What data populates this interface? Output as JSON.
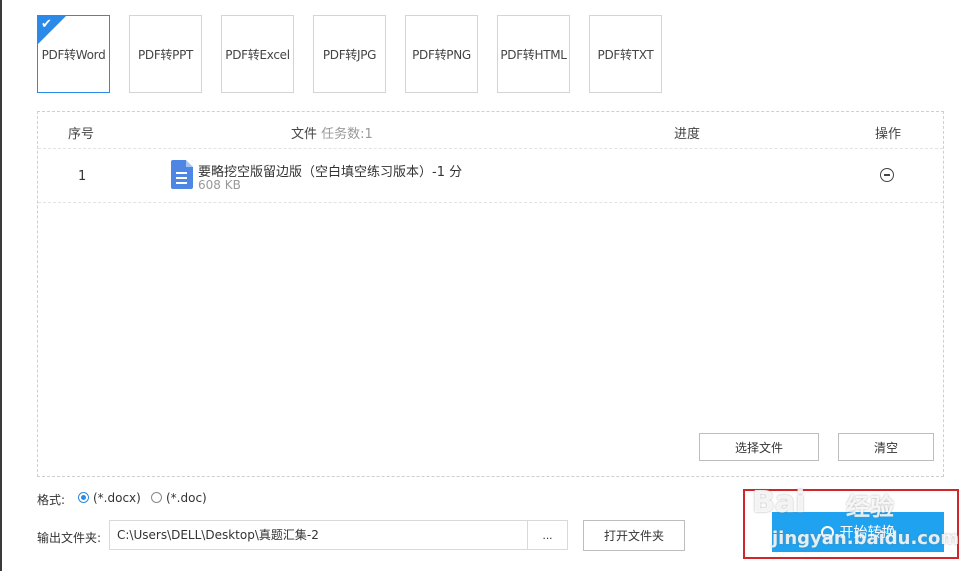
{
  "tabs": [
    {
      "label": "PDF转Word",
      "active": true
    },
    {
      "label": "PDF转PPT",
      "active": false
    },
    {
      "label": "PDF转Excel",
      "active": false
    },
    {
      "label": "PDF转JPG",
      "active": false
    },
    {
      "label": "PDF转PNG",
      "active": false
    },
    {
      "label": "PDF转HTML",
      "active": false
    },
    {
      "label": "PDF转TXT",
      "active": false
    }
  ],
  "table": {
    "col_index": "序号",
    "col_file": "文件",
    "task_count": "任务数:1",
    "col_progress": "进度",
    "col_action": "操作",
    "rows": [
      {
        "index": "1",
        "name": "要略挖空版留边版（空白填空练习版本）-1 分",
        "size": "608 KB"
      }
    ],
    "select_file_label": "选择文件",
    "clear_label": "清空"
  },
  "format": {
    "label": "格式:",
    "options": [
      {
        "label": "(*.docx)",
        "selected": true
      },
      {
        "label": "(*.doc)",
        "selected": false
      }
    ]
  },
  "output": {
    "label": "输出文件夹:",
    "path": "C:\\Users\\DELL\\Desktop\\真题汇集-2",
    "browse_label": "...",
    "open_folder_label": "打开文件夹"
  },
  "start_label": "开始转换",
  "watermark": {
    "brand": "Bai",
    "brand2": "经验",
    "site": "jingyan.baidu.com"
  },
  "colors": {
    "accent": "#2b8ae8",
    "start_button": "#1fa3f0",
    "highlight": "#d0262a"
  }
}
